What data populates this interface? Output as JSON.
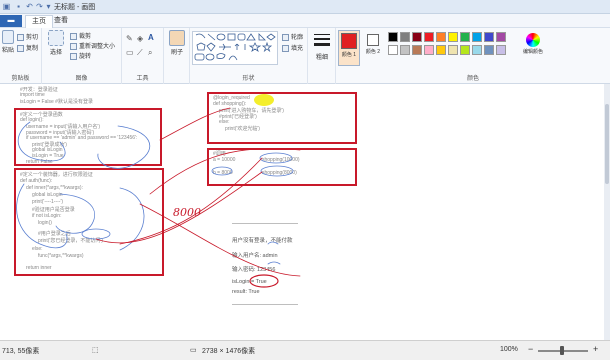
{
  "titlebar": {
    "title": "无标题 - 画图"
  },
  "tabs": {
    "file": "▬",
    "home": "主页",
    "view": "查看"
  },
  "ribbon": {
    "clipboard": {
      "paste": "粘贴",
      "cut": "剪切",
      "copy": "复制",
      "label": "剪贴板"
    },
    "image": {
      "select": "选择",
      "crop": "裁剪",
      "resize": "重新调整大小",
      "rotate": "旋转",
      "label": "图像"
    },
    "tools": {
      "label": "工具"
    },
    "brushes": {
      "label": "刷子"
    },
    "shapes": {
      "outline": "轮廓",
      "fill": "填充",
      "label": "形状"
    },
    "size": {
      "label": "粗细"
    },
    "colors": {
      "color1": "颜色 1",
      "color2": "颜色 2",
      "edit": "编辑颜色",
      "label": "颜色",
      "color1_value": "#e02020",
      "palette": [
        "#000000",
        "#7f7f7f",
        "#880015",
        "#ed1c24",
        "#ff7f27",
        "#fff200",
        "#22b14c",
        "#00a2e8",
        "#3f48cc",
        "#a349a4",
        "#ffffff",
        "#c3c3c3",
        "#b97a57",
        "#ffaec9",
        "#ffc90e",
        "#efe4b0",
        "#b5e61d",
        "#99d9ea",
        "#7092be",
        "#c8bfe7"
      ]
    }
  },
  "canvas": {
    "box1_lines": [
      "#开发：登录验证",
      "import time",
      "isLogin = False  #默认是没有登录"
    ],
    "box2_lines": [
      "#定义一个登录函数",
      "def login():",
      "username = input('请输入用户名')",
      "password = input('请输入密码')",
      "if username == 'admin' and password == '123456':",
      "print('登录成功')",
      "global isLogin",
      "isLogin = True",
      "return False"
    ],
    "box3_lines": [
      "#定义一个装饰器，进行权限验证",
      "def auth(func):",
      "def inner(*args,**kwargs):",
      "global isLogin",
      "print('----1----')",
      "#验证用户是否登录",
      "if not isLogin:",
      "login()",
      "#用户登录之后",
      "print('您已经登录，不能访问')",
      "else:",
      "func(*args,**kwargs)",
      "return inner"
    ],
    "box4_lines": [
      "@login_required",
      "def shopping():",
      "print('进入购物车，请先登录')",
      "#print('已经登录')",
      "else:",
      "print('欢迎光临')"
    ],
    "box5_lines": [
      "#调用",
      "a = 10000",
      "b = 8000"
    ],
    "box5_right": [
      "shopping(10000)",
      "shopping(8000)"
    ],
    "handwritten": "8000",
    "output_lines": [
      "————————————",
      "用户没有登录，不能付款",
      "输入用户名: admin",
      "输入密码: 123456",
      "isLogin = True",
      "result: True",
      "————————————"
    ]
  },
  "statusbar": {
    "cursor_pos": "713, 55像素",
    "image_size": "2738 × 1476像素",
    "zoom": "100%"
  }
}
